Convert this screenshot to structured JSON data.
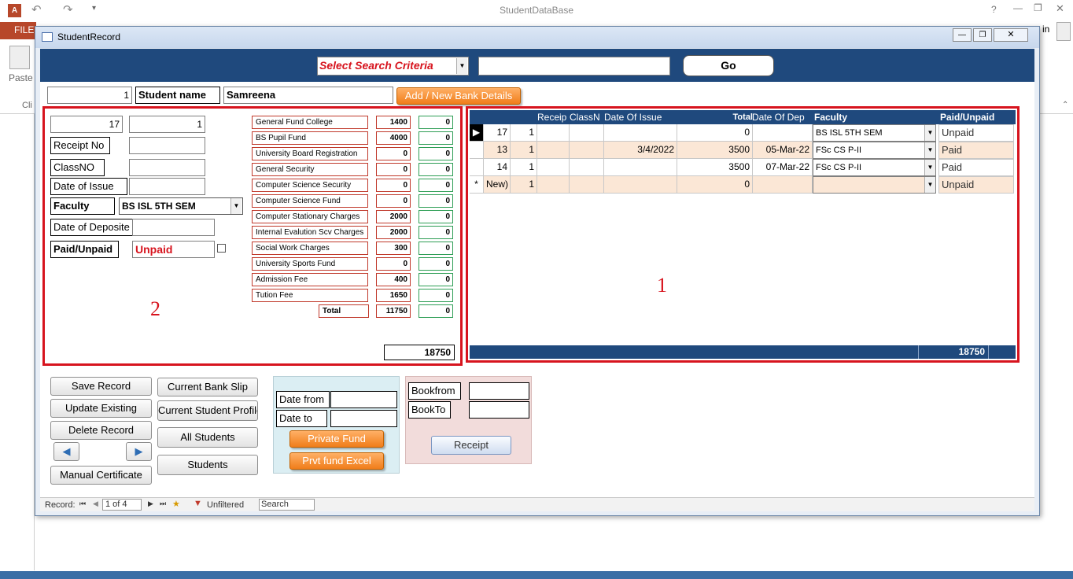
{
  "app": {
    "title": "StudentDataBase",
    "file_tab": "FILE",
    "paste_label": "Paste",
    "clip_label": "Cli",
    "signin_fragment": "in",
    "help": "?"
  },
  "form": {
    "caption": "StudentRecord",
    "search": {
      "criteria_label": "Select Search Criteria",
      "query_value": "",
      "go_label": "Go"
    },
    "student": {
      "record_id": "1",
      "name_label": "Student name",
      "name_value": "Samreena",
      "add_bank_label": "Add / New Bank Details"
    },
    "detail": {
      "field_a": "17",
      "field_b": "1",
      "receipt_label": "Receipt No",
      "receipt_value": "",
      "classno_label": "ClassNO",
      "classno_value": "",
      "issue_label": "Date of Issue",
      "issue_value": "",
      "faculty_label": "Faculty",
      "faculty_value": "BS ISL 5TH SEM",
      "deposite_label": "Date of Deposite",
      "deposite_value": "",
      "paid_label": "Paid/Unpaid",
      "paid_value": "Unpaid",
      "section_number": "2",
      "grand_total": "18750"
    },
    "fees": [
      {
        "label": "General Fund College",
        "value": "1400",
        "paid": "0"
      },
      {
        "label": "BS Pupil Fund",
        "value": "4000",
        "paid": "0"
      },
      {
        "label": "University Board Registration",
        "value": "0",
        "paid": "0"
      },
      {
        "label": "General Security",
        "value": "0",
        "paid": "0"
      },
      {
        "label": "Computer Science Security",
        "value": "0",
        "paid": "0"
      },
      {
        "label": "Computer Science Fund",
        "value": "0",
        "paid": "0"
      },
      {
        "label": "Computer Stationary Charges",
        "value": "2000",
        "paid": "0"
      },
      {
        "label": "Internal Evalution Scv Charges",
        "value": "2000",
        "paid": "0"
      },
      {
        "label": "Social Work Charges",
        "value": "300",
        "paid": "0"
      },
      {
        "label": "University Sports Fund",
        "value": "0",
        "paid": "0"
      },
      {
        "label": "Admission Fee",
        "value": "400",
        "paid": "0"
      },
      {
        "label": "Tution Fee",
        "value": "1650",
        "paid": "0"
      }
    ],
    "fee_total": {
      "label": "Total",
      "value": "11750",
      "paid": "0"
    },
    "grid": {
      "headers": [
        "Receip",
        "ClassN",
        "Date Of Issue",
        "Total",
        "Date Of Dep",
        "Faculty",
        "Paid/Unpaid"
      ],
      "rows": [
        {
          "a": "17",
          "b": "1",
          "receipt": "",
          "classno": "",
          "issue": "",
          "total": "0",
          "deposit": "",
          "faculty": "BS ISL 5TH SEM",
          "status": "Unpaid"
        },
        {
          "a": "13",
          "b": "1",
          "receipt": "",
          "classno": "",
          "issue": "3/4/2022",
          "total": "3500",
          "deposit": "05-Mar-22",
          "faculty": "FSc CS P-II",
          "status": "Paid"
        },
        {
          "a": "14",
          "b": "1",
          "receipt": "",
          "classno": "",
          "issue": "",
          "total": "3500",
          "deposit": "07-Mar-22",
          "faculty": "FSc CS P-II",
          "status": "Paid"
        },
        {
          "a": "New)",
          "b": "1",
          "receipt": "",
          "classno": "",
          "issue": "",
          "total": "0",
          "deposit": "",
          "faculty": "",
          "status": "Unpaid"
        }
      ],
      "new_marker": "*",
      "footer_total": "18750",
      "section_number": "1"
    },
    "buttons": {
      "save": "Save Record",
      "update": "Update Existing",
      "delete": "Delete Record",
      "manual": "Manual Certificate",
      "bank_slip": "Current Bank Slip",
      "current_student": "Current Student Profile",
      "all_students": "All Students",
      "students": "Students"
    },
    "date_panel": {
      "from_label": "Date from",
      "from_value": "",
      "to_label": "Date to",
      "to_value": "",
      "private_fund": "Private Fund",
      "private_excel": "Prvt fund Excel"
    },
    "book_panel": {
      "from_label": "Bookfrom",
      "from_value": "",
      "to_label": "BookTo",
      "to_value": "",
      "receipt": "Receipt"
    },
    "navigation": {
      "record_label": "Record:",
      "position": "1 of 4",
      "filter": "Unfiltered",
      "search": "Search"
    }
  },
  "colors": {
    "header_band": "#1f497d",
    "highlight_red": "#d7141e",
    "orange": "#f07d1a",
    "row_alt": "#fbe7d6"
  }
}
